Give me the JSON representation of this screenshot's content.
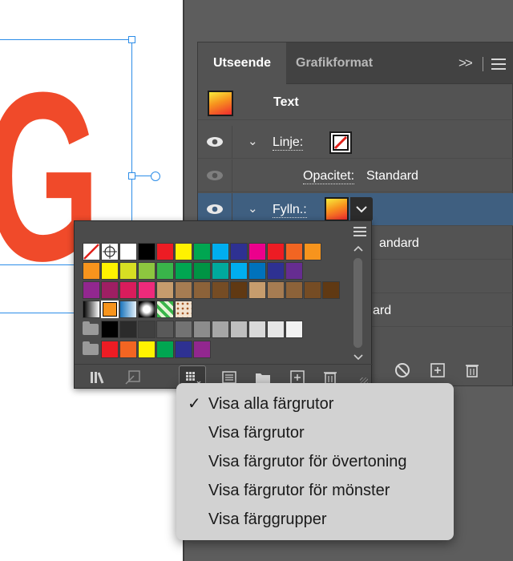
{
  "canvas": {
    "art_text": "IG"
  },
  "appearance_panel": {
    "tabs": [
      {
        "label": "Utseende"
      },
      {
        "label": "Grafikformat"
      }
    ],
    "collapse_icon": "double-chevron-right-icon",
    "menu_icon": "hamburger-icon",
    "header_label": "Text",
    "rows": {
      "stroke_label": "Linje:",
      "stroke_opacity_key": "Opacitet:",
      "stroke_opacity_value": "Standard",
      "fill_label": "Fylln.:",
      "hidden_fragment_1": "andard",
      "hidden_fragment_2": "ard"
    },
    "bottom_icons": [
      "no-symbol-icon",
      "add-new-icon",
      "trash-icon"
    ]
  },
  "swatches_popup": {
    "footer_icons": [
      "swatch-libraries-icon",
      "place-swatches-icon",
      "show-swatch-kinds-icon",
      "swatch-options-icon",
      "new-color-group-icon",
      "new-swatch-icon",
      "delete-swatch-icon"
    ],
    "colors": {
      "row1": [
        "#ffffff",
        "#000000",
        "#ed1c24",
        "#fff200",
        "#00a651",
        "#00aeef",
        "#2e3192",
        "#ec008c",
        "#ed1c24",
        "#f26522",
        "#f7941d"
      ],
      "row2": [
        "#f7941d",
        "#fff200",
        "#d7df23",
        "#8dc63f",
        "#39b54a",
        "#00a651",
        "#009444",
        "#00a99d",
        "#00aeef",
        "#0072bc",
        "#2e3192",
        "#662d91"
      ],
      "row3": [
        "#92278f",
        "#9e1f63",
        "#d91c5c",
        "#ee2a7b",
        "#c69c6d",
        "#a67c52",
        "#8c6239",
        "#754c24",
        "#603913",
        "#c69c6d",
        "#a67c52",
        "#8c6239",
        "#754c24",
        "#603913"
      ],
      "grays": [
        "#000000",
        "#2b2b2b",
        "#404040",
        "#595959",
        "#737373",
        "#8c8c8c",
        "#a6a6a6",
        "#bfbfbf",
        "#d9d9d9",
        "#e6e6e6",
        "#f2f2f2"
      ],
      "group": [
        "#ed1c24",
        "#f26522",
        "#fff200",
        "#00a651",
        "#2e3192",
        "#92278f"
      ]
    }
  },
  "context_menu": {
    "check": "✓",
    "items": [
      {
        "label": "Visa alla färgrutor",
        "checked": true
      },
      {
        "label": "Visa färgrutor"
      },
      {
        "label": "Visa färgrutor för övertoning"
      },
      {
        "label": "Visa färgrutor för mönster"
      },
      {
        "label": "Visa färggrupper"
      }
    ]
  }
}
